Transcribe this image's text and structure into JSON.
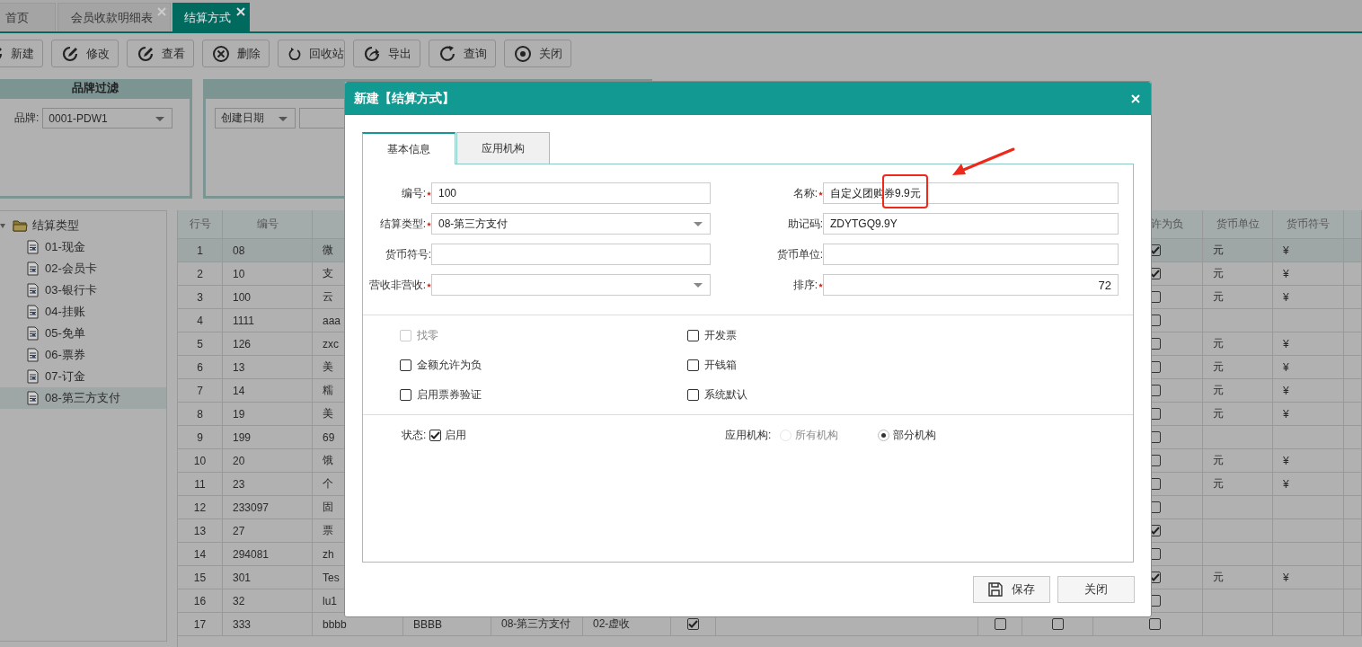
{
  "tabs": [
    {
      "label": "首页",
      "selected": false,
      "closable": false
    },
    {
      "label": "会员收款明细表",
      "selected": false,
      "closable": true
    },
    {
      "label": "结算方式",
      "selected": true,
      "closable": true
    }
  ],
  "toolbar": [
    {
      "label": "新建",
      "kind": "new"
    },
    {
      "label": "修改",
      "kind": "edit"
    },
    {
      "label": "查看",
      "kind": "view"
    },
    {
      "label": "删除",
      "kind": "delete"
    },
    {
      "label": "回收站",
      "kind": "recycle"
    },
    {
      "label": "导出",
      "kind": "export"
    },
    {
      "label": "查询",
      "kind": "query"
    },
    {
      "label": "关闭",
      "kind": "close"
    }
  ],
  "brand_filter": {
    "title": "品牌过滤",
    "label": "品牌:",
    "value": "0001-PDW1"
  },
  "date_filter": {
    "value": "创建日期"
  },
  "tree": {
    "label": "结算类型",
    "expanded": true,
    "children": [
      {
        "label": "01-现金",
        "selected": false
      },
      {
        "label": "02-会员卡",
        "selected": false
      },
      {
        "label": "03-银行卡",
        "selected": false
      },
      {
        "label": "04-挂账",
        "selected": false
      },
      {
        "label": "05-免单",
        "selected": false
      },
      {
        "label": "06-票券",
        "selected": false
      },
      {
        "label": "07-订金",
        "selected": false
      },
      {
        "label": "08-第三方支付",
        "selected": true
      }
    ]
  },
  "table": {
    "columns": {
      "row_no": "行号",
      "code": "编号",
      "allow_negative": "许为负",
      "unit": "货币单位",
      "symbol": "货币符号"
    },
    "rows": [
      {
        "row_no": "1",
        "code": "08",
        "column_3": "微",
        "selected": true,
        "allow_negative": true,
        "unit": "元",
        "symbol": "¥"
      },
      {
        "row_no": "2",
        "code": "10",
        "column_3": "支",
        "selected": false,
        "allow_negative": true,
        "unit": "元",
        "symbol": "¥"
      },
      {
        "row_no": "3",
        "code": "100",
        "column_3": "云",
        "selected": false,
        "allow_negative": false,
        "unit": "元",
        "symbol": "¥"
      },
      {
        "row_no": "4",
        "code": "1111",
        "column_3": "aaa",
        "selected": false,
        "allow_negative": false
      },
      {
        "row_no": "5",
        "code": "126",
        "column_3": "zxc",
        "selected": false,
        "allow_negative": false,
        "unit": "元",
        "symbol": "¥"
      },
      {
        "row_no": "6",
        "code": "13",
        "column_3": "美",
        "selected": false,
        "allow_negative": false,
        "unit": "元",
        "symbol": "¥"
      },
      {
        "row_no": "7",
        "code": "14",
        "column_3": "糯",
        "selected": false,
        "allow_negative": false,
        "unit": "元",
        "symbol": "¥"
      },
      {
        "row_no": "8",
        "code": "19",
        "column_3": "美",
        "selected": false,
        "allow_negative": false,
        "unit": "元",
        "symbol": "¥"
      },
      {
        "row_no": "9",
        "code": "199",
        "column_3": "69",
        "selected": false,
        "allow_negative": false
      },
      {
        "row_no": "10",
        "code": "20",
        "column_3": "饿",
        "selected": false,
        "allow_negative": false,
        "unit": "元",
        "symbol": "¥"
      },
      {
        "row_no": "11",
        "code": "23",
        "column_3": "个",
        "selected": false,
        "allow_negative": false,
        "unit": "元",
        "symbol": "¥"
      },
      {
        "row_no": "12",
        "code": "233097",
        "column_3": "固",
        "selected": false,
        "allow_negative": false
      },
      {
        "row_no": "13",
        "code": "27",
        "column_3": "票",
        "selected": false,
        "allow_negative": true
      },
      {
        "row_no": "14",
        "code": "294081",
        "column_3": "zh",
        "selected": false,
        "allow_negative": false
      },
      {
        "row_no": "15",
        "code": "301",
        "column_3": "Tes",
        "selected": false,
        "allow_negative": true,
        "unit": "元",
        "symbol": "¥"
      },
      {
        "row_no": "16",
        "code": "32",
        "column_3": "lu1",
        "selected": false,
        "allow_negative": false
      },
      {
        "row_no": "17",
        "code": "333",
        "column_3": "bbbb",
        "column_4": "BBBB",
        "column_5": "08-第三方支付",
        "column_6": "02-虚收",
        "column_7": true,
        "column_9": false,
        "column_10": false,
        "selected": false,
        "allow_negative": false
      }
    ]
  },
  "dialog": {
    "title": "新建【结算方式】",
    "tabs": [
      {
        "label": "基本信息",
        "selected": true
      },
      {
        "label": "应用机构",
        "selected": false
      }
    ],
    "fields": [
      {
        "label": "编号:",
        "required": true,
        "kind": "text",
        "value": "100"
      },
      {
        "label": "名称:",
        "required": true,
        "kind": "text",
        "value": "自定义团购券9.9元"
      },
      {
        "label": "结算类型:",
        "required": true,
        "kind": "select",
        "value": "08-第三方支付"
      },
      {
        "label": "助记码:",
        "required": false,
        "kind": "text",
        "value": "ZDYTGQ9.9Y"
      },
      {
        "label": "货币符号:",
        "required": false,
        "kind": "text"
      },
      {
        "label": "货币单位:",
        "required": false,
        "kind": "text"
      },
      {
        "label": "营收非营收:",
        "required": true,
        "kind": "select"
      },
      {
        "label": "排序:",
        "required": true,
        "kind": "number",
        "value": "72"
      }
    ],
    "options": [
      {
        "label": "找零",
        "checked": false,
        "disabled": true
      },
      {
        "label": "开发票",
        "checked": false,
        "disabled": false
      },
      {
        "label": "金额允许为负",
        "checked": false,
        "disabled": false
      },
      {
        "label": "开钱箱",
        "checked": false,
        "disabled": false
      },
      {
        "label": "启用票券验证",
        "checked": false,
        "disabled": false
      },
      {
        "label": "系统默认",
        "checked": false,
        "disabled": false
      }
    ],
    "status": {
      "label": "状态:",
      "option": "启用",
      "checked": true
    },
    "apply_org": {
      "label": "应用机构:",
      "choices": [
        {
          "label": "所有机构",
          "selected": false,
          "disabled": true
        },
        {
          "label": "部分机构",
          "selected": true,
          "disabled": false
        }
      ]
    },
    "buttons": [
      {
        "label": "保存",
        "kind": "save"
      },
      {
        "label": "关闭",
        "kind": "close"
      }
    ]
  },
  "annotation": {
    "kind": "callout"
  }
}
